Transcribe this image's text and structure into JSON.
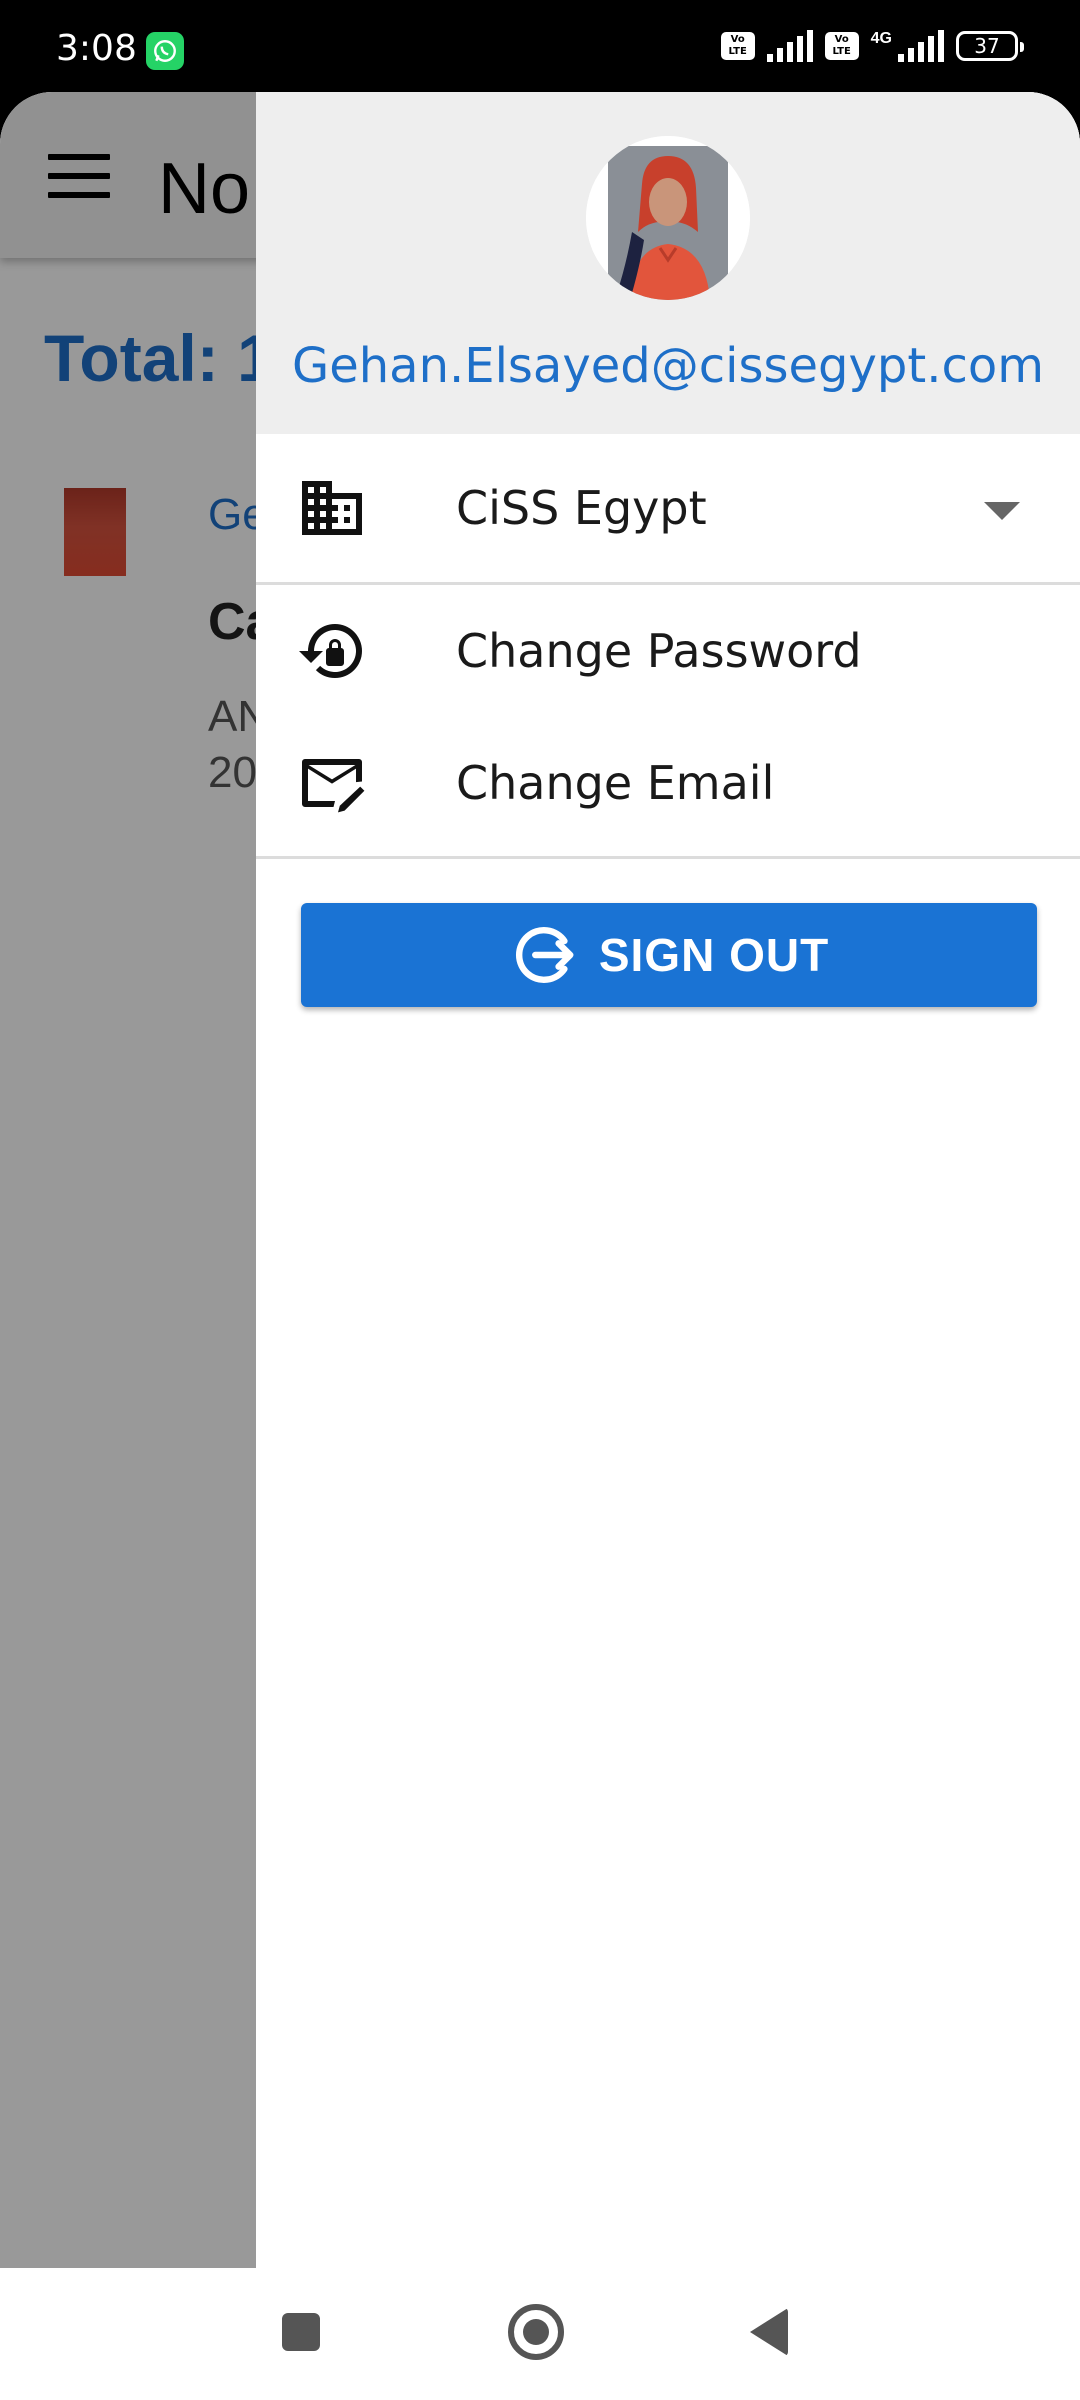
{
  "status_bar": {
    "time": "3:08",
    "volte_1": "Vo LTE",
    "volte_2": "Vo LTE",
    "network_type": "4G",
    "battery_level": "37",
    "notification_icon": "whatsapp-icon"
  },
  "background_screen": {
    "title": "No",
    "total_label": "Total: 1",
    "list_item_name": "Ge",
    "list_item_heading": "Ca",
    "list_item_line1": "AN",
    "list_item_line2": "20"
  },
  "drawer": {
    "user_email": "Gehan.Elsayed@cissegypt.com",
    "organization": {
      "label": "CiSS Egypt",
      "icon": "building-icon"
    },
    "menu_items": [
      {
        "label": "Change Password",
        "icon": "lock-reset-icon"
      },
      {
        "label": "Change Email",
        "icon": "email-edit-icon"
      }
    ],
    "sign_out_label": "SIGN OUT"
  },
  "colors": {
    "accent": "#1e6fc8",
    "button": "#1a73d4",
    "header_bg": "#eeeeee"
  }
}
